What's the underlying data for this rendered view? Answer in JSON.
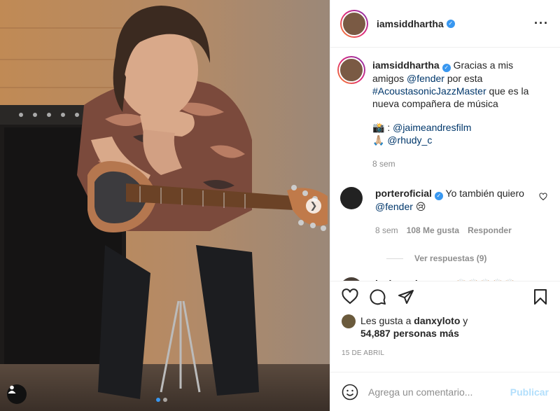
{
  "post": {
    "username": "iamsiddhartha",
    "caption": {
      "username": "iamsiddhartha",
      "text_1": "Gracias a mis amigos",
      "mention_1": "@fender",
      "text_2": "por esta",
      "hashtag": "#AcoustasonicJazzMaster",
      "text_3": "que es la nueva compañera de música",
      "credit_1_prefix": "📸 :",
      "credit_1_mention": "@jaimeandresfilm",
      "credit_2_prefix": "🙏🏼",
      "credit_2_mention": "@rhudy_c",
      "time": "8 sem"
    },
    "comments": [
      {
        "username": "porteroficial",
        "text": "Yo también quiero",
        "mention": "@fender",
        "emoji": "😢",
        "time": "8 sem",
        "likes": "108 Me gusta",
        "reply": "Responder",
        "view_replies": "Ver respuestas (9)"
      },
      {
        "username": "javier_minano",
        "emoji": "🙌🏼🙌🏼🙌🏼🙌🏼🙌🏼"
      }
    ],
    "likes": {
      "prefix": "Les gusta a",
      "user": "danxyloto",
      "mid": "y",
      "count": "54,887 personas más"
    },
    "date": "15 DE ABRIL",
    "add_comment_placeholder": "Agrega un comentario...",
    "publish_label": "Publicar"
  },
  "icons": [
    "more-icon",
    "verified-icon",
    "heart-icon",
    "comment-icon",
    "share-icon",
    "bookmark-icon",
    "emoji-icon",
    "next-arrow-icon",
    "user-tag-icon"
  ],
  "colors": {
    "link": "#00376b",
    "verified": "#3897f0",
    "muted": "#8e8e8e",
    "publish": "#b2dffc"
  }
}
